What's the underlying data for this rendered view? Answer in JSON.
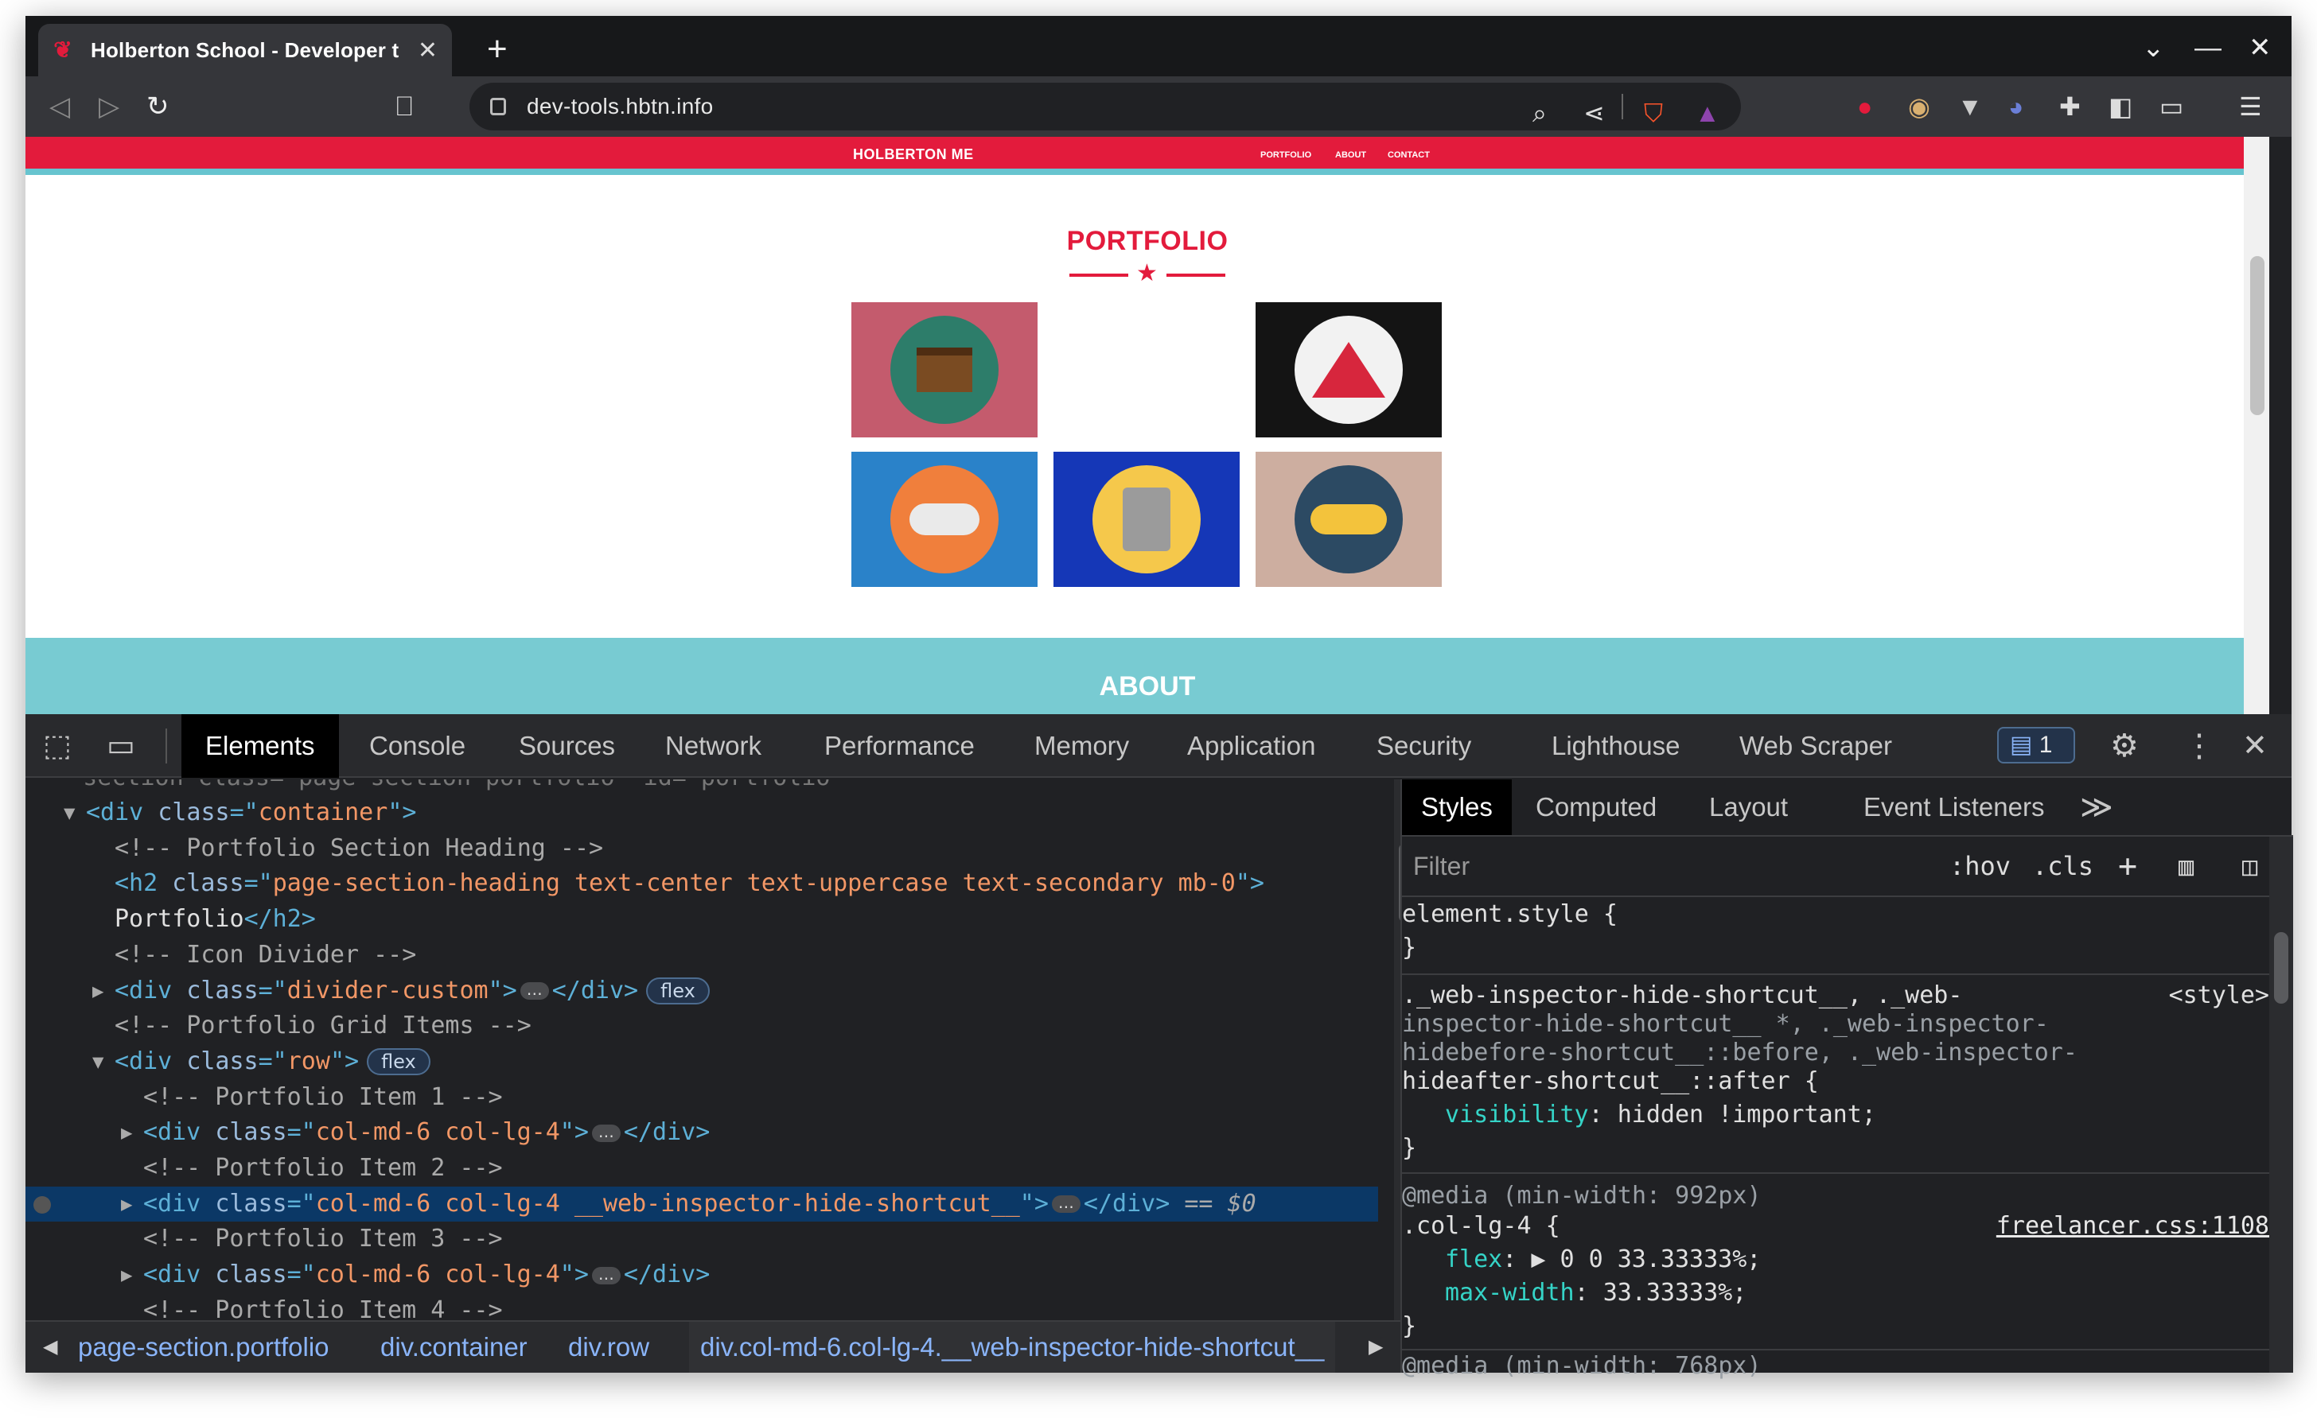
{
  "browser": {
    "tab_title": "Holberton School - Developer t",
    "url": "dev-tools.hbtn.info"
  },
  "site": {
    "brand": "HOLBERTON ME",
    "nav": [
      "PORTFOLIO",
      "ABOUT",
      "CONTACT"
    ],
    "portfolio_title": "PORTFOLIO",
    "about_title": "ABOUT",
    "cards": [
      {
        "name": "cabin",
        "bg": "#c45b6d",
        "circle": "#2d7d6a"
      },
      {
        "name": "hidden",
        "bg": "#ffffff",
        "circle": "#ffffff"
      },
      {
        "name": "circus",
        "bg": "#141414",
        "circle": "#f2f2f2"
      },
      {
        "name": "game",
        "bg": "#2a82c9",
        "circle": "#f07f3c"
      },
      {
        "name": "safe",
        "bg": "#1537b7",
        "circle": "#f5c84b"
      },
      {
        "name": "submarine",
        "bg": "#cdaea0",
        "circle": "#2c4a63"
      }
    ]
  },
  "devtools": {
    "tabs": [
      "Elements",
      "Console",
      "Sources",
      "Network",
      "Performance",
      "Memory",
      "Application",
      "Security",
      "Lighthouse",
      "Web Scraper"
    ],
    "issues_count": "1",
    "dom_lines": [
      {
        "indent": 0,
        "arrow": "▼",
        "parts": [
          [
            "tg",
            "<div "
          ],
          [
            "at",
            "class"
          ],
          [
            "tg",
            "=\""
          ],
          [
            "av",
            "container"
          ],
          [
            "tg",
            "\">"
          ]
        ]
      },
      {
        "indent": 1,
        "arrow": "",
        "parts": [
          [
            "cm",
            "<!-- Portfolio Section Heading -->"
          ]
        ]
      },
      {
        "indent": 1,
        "arrow": "",
        "parts": [
          [
            "tg",
            "<h2 "
          ],
          [
            "at",
            "class"
          ],
          [
            "tg",
            "=\""
          ],
          [
            "av",
            "page-section-heading text-center text-uppercase text-secondary mb-0"
          ],
          [
            "tg",
            "\">"
          ]
        ]
      },
      {
        "indent": 1,
        "arrow": "",
        "parts": [
          [
            "tx",
            "Portfolio"
          ],
          [
            "tg",
            "</h2>"
          ]
        ]
      },
      {
        "indent": 1,
        "arrow": "",
        "parts": [
          [
            "cm",
            "<!-- Icon Divider -->"
          ]
        ]
      },
      {
        "indent": 1,
        "arrow": "▶",
        "parts": [
          [
            "tg",
            "<div "
          ],
          [
            "at",
            "class"
          ],
          [
            "tg",
            "=\""
          ],
          [
            "av",
            "divider-custom"
          ],
          [
            "tg",
            "\">"
          ],
          [
            "ell",
            "…"
          ],
          [
            "tg",
            "</div>"
          ],
          [
            "badge",
            "flex"
          ]
        ]
      },
      {
        "indent": 1,
        "arrow": "",
        "parts": [
          [
            "cm",
            "<!-- Portfolio Grid Items -->"
          ]
        ]
      },
      {
        "indent": 1,
        "arrow": "▼",
        "parts": [
          [
            "tg",
            "<div "
          ],
          [
            "at",
            "class"
          ],
          [
            "tg",
            "=\""
          ],
          [
            "av",
            "row"
          ],
          [
            "tg",
            "\">"
          ],
          [
            "badge",
            "flex"
          ]
        ]
      },
      {
        "indent": 2,
        "arrow": "",
        "parts": [
          [
            "cm",
            "<!-- Portfolio Item 1 -->"
          ]
        ]
      },
      {
        "indent": 2,
        "arrow": "▶",
        "parts": [
          [
            "tg",
            "<div "
          ],
          [
            "at",
            "class"
          ],
          [
            "tg",
            "=\""
          ],
          [
            "av",
            "col-md-6 col-lg-4"
          ],
          [
            "tg",
            "\">"
          ],
          [
            "ell",
            "…"
          ],
          [
            "tg",
            "</div>"
          ]
        ]
      },
      {
        "indent": 2,
        "arrow": "",
        "parts": [
          [
            "cm",
            "<!-- Portfolio Item 2 -->"
          ]
        ]
      },
      {
        "indent": 2,
        "arrow": "▶",
        "sel": true,
        "parts": [
          [
            "tg",
            "<div "
          ],
          [
            "at",
            "class"
          ],
          [
            "tg",
            "=\""
          ],
          [
            "av",
            "col-md-6 col-lg-4 __web-inspector-hide-shortcut__"
          ],
          [
            "tg",
            "\">"
          ],
          [
            "ell",
            "…"
          ],
          [
            "tg",
            "</div>"
          ],
          [
            "cm",
            " == $0"
          ]
        ]
      },
      {
        "indent": 2,
        "arrow": "",
        "parts": [
          [
            "cm",
            "<!-- Portfolio Item 3 -->"
          ]
        ]
      },
      {
        "indent": 2,
        "arrow": "▶",
        "parts": [
          [
            "tg",
            "<div "
          ],
          [
            "at",
            "class"
          ],
          [
            "tg",
            "=\""
          ],
          [
            "av",
            "col-md-6 col-lg-4"
          ],
          [
            "tg",
            "\">"
          ],
          [
            "ell",
            "…"
          ],
          [
            "tg",
            "</div>"
          ]
        ]
      },
      {
        "indent": 2,
        "arrow": "",
        "parts": [
          [
            "cm",
            "<!-- Portfolio Item 4 -->"
          ]
        ]
      }
    ],
    "breadcrumbs": [
      "page-section.portfolio",
      "div.container",
      "div.row",
      "div.col-md-6.col-lg-4.__web-inspector-hide-shortcut__"
    ],
    "styles_tabs": [
      "Styles",
      "Computed",
      "Layout",
      "Event Listeners"
    ],
    "filter_placeholder": "Filter",
    "hov": ":hov",
    "cls": ".cls",
    "rule1": {
      "selector": "element.style {",
      "close": "}"
    },
    "rule2": {
      "selector_lines": [
        "._web-inspector-hide-shortcut__, ._web-",
        "inspector-hide-shortcut__ *, ._web-inspector-",
        "hidebefore-shortcut__::before, ._web-inspector-",
        "hideafter-shortcut__::after {"
      ],
      "source": "<style>",
      "prop": "visibility",
      "value": "hidden !important;",
      "close": "}"
    },
    "rule3": {
      "media": "@media (min-width: 992px)",
      "selector": ".col-lg-4 {",
      "source": "freelancer.css:1108",
      "props": [
        [
          "flex",
          "▶ 0 0 33.33333%;"
        ],
        [
          "max-width",
          "33.33333%;"
        ]
      ],
      "close": "}"
    },
    "rule4": {
      "media": "@media (min-width: 768px)"
    }
  }
}
